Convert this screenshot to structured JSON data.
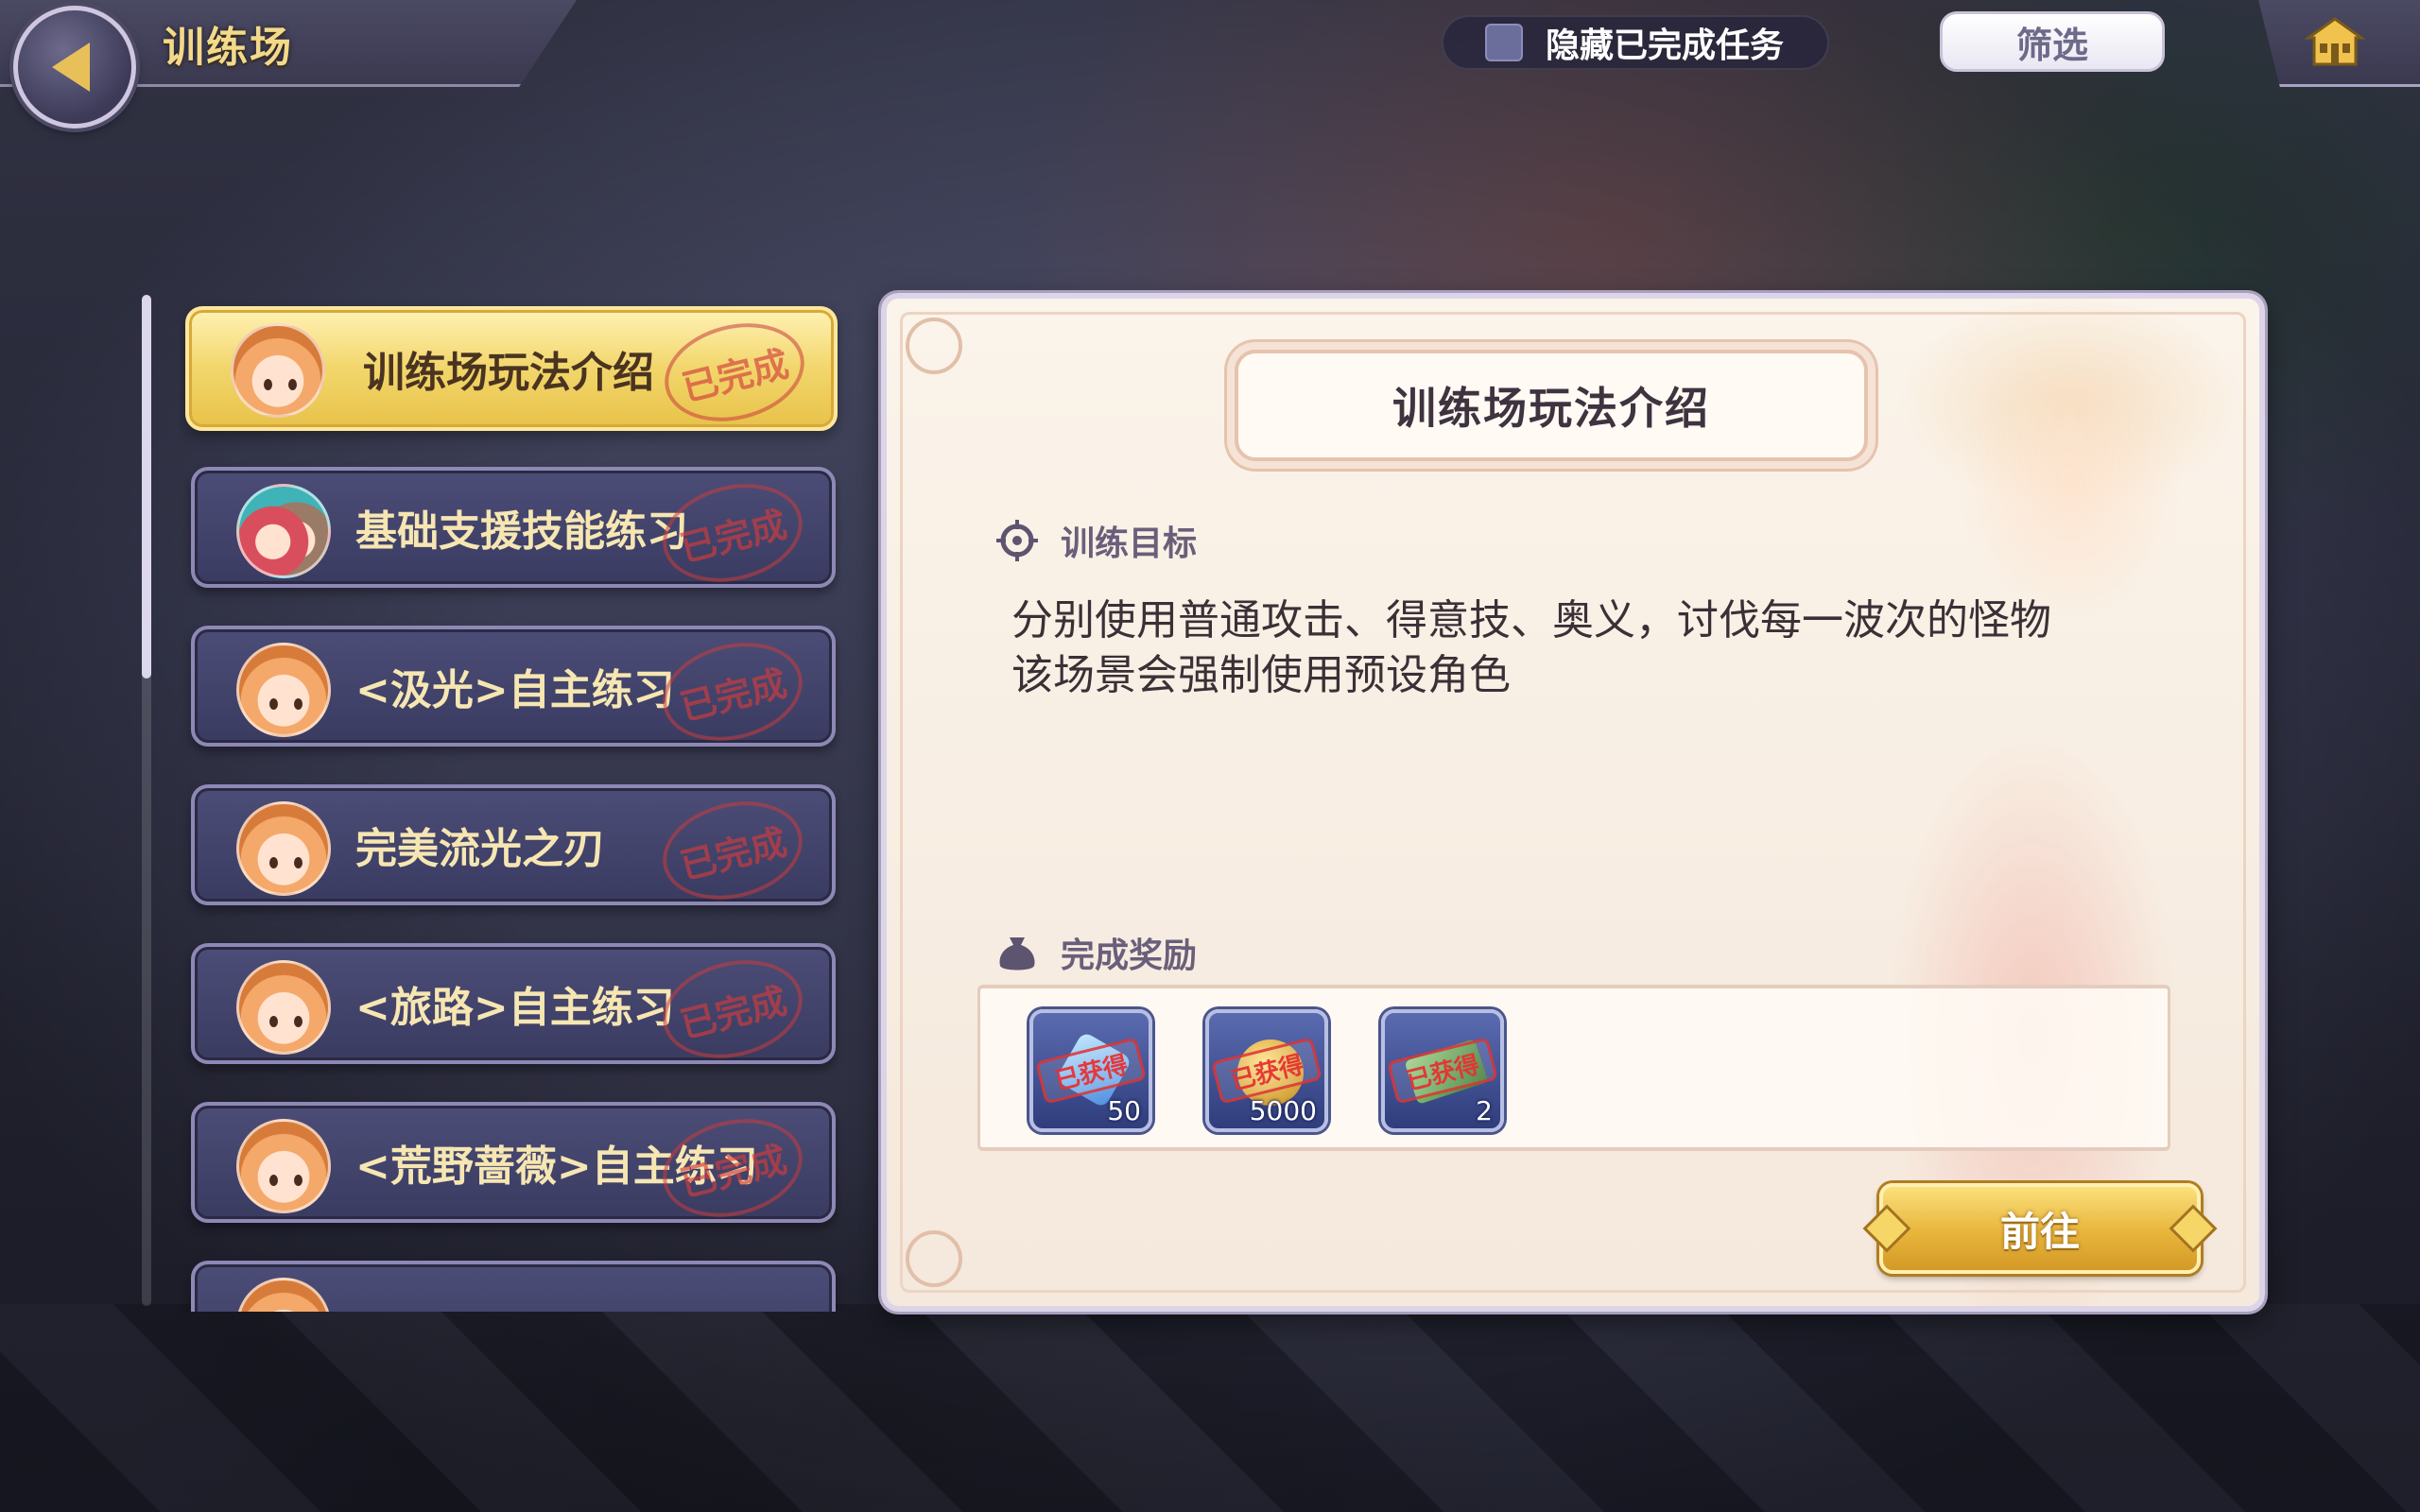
{
  "header": {
    "title": "训练场",
    "hide_completed_label": "隐藏已完成任务",
    "hide_completed_checked": false,
    "filter_label": "筛选"
  },
  "list": {
    "items": [
      {
        "label": "训练场玩法介绍",
        "stamp": "已完成",
        "active": true
      },
      {
        "label": "基础支援技能练习",
        "stamp": "已完成",
        "active": false
      },
      {
        "label": "<汲光>自主练习",
        "stamp": "已完成",
        "active": false
      },
      {
        "label": "完美流光之刃",
        "stamp": "已完成",
        "active": false
      },
      {
        "label": "<旅路>自主练习",
        "stamp": "已完成",
        "active": false
      },
      {
        "label": "<荒野蔷薇>自主练习",
        "stamp": "已完成",
        "active": false
      }
    ]
  },
  "detail": {
    "title": "训练场玩法介绍",
    "goal_heading": "训练目标",
    "goal_lines": [
      "分别使用普通攻击、得意技、奥义，讨伐每一波次的怪物",
      "该场景会强制使用预设角色"
    ],
    "reward_heading": "完成奖励",
    "rewards": [
      {
        "icon": "gem-icon",
        "count": "50",
        "status": "已获得"
      },
      {
        "icon": "coin-icon",
        "count": "5000",
        "status": "已获得"
      },
      {
        "icon": "ticket-icon",
        "count": "2",
        "status": "已获得"
      }
    ],
    "go_label": "前往"
  },
  "colors": {
    "accent_gold": "#e8b53b",
    "list_bg": "#3a3b61",
    "panel_bg": "#fbf4ea",
    "stamp_red": "#d23c3c"
  }
}
